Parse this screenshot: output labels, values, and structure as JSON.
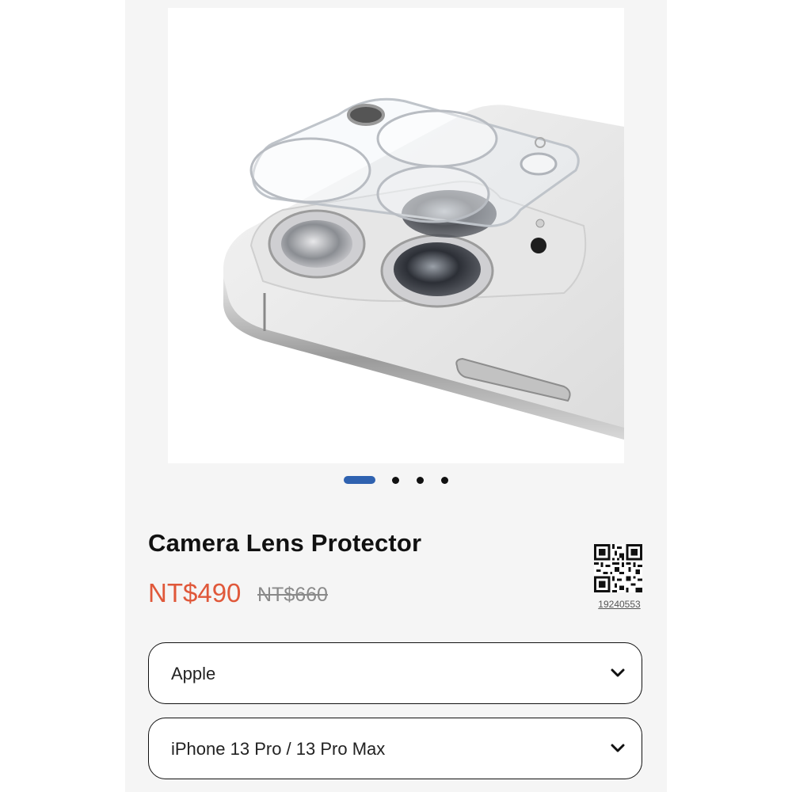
{
  "product": {
    "title": "Camera Lens Protector",
    "price": "NT$490",
    "original_price": "NT$660",
    "qr_code_number": "19240553",
    "image_count": 4,
    "active_image": 1
  },
  "selects": {
    "brand": {
      "value": "Apple",
      "icon": "chevron-down-icon"
    },
    "model": {
      "value": "iPhone 13 Pro / 13 Pro Max",
      "icon": "chevron-down-icon"
    }
  },
  "colors": {
    "accent": "#2f62b0",
    "price": "#e0583a",
    "panel": "#f5f5f5"
  }
}
